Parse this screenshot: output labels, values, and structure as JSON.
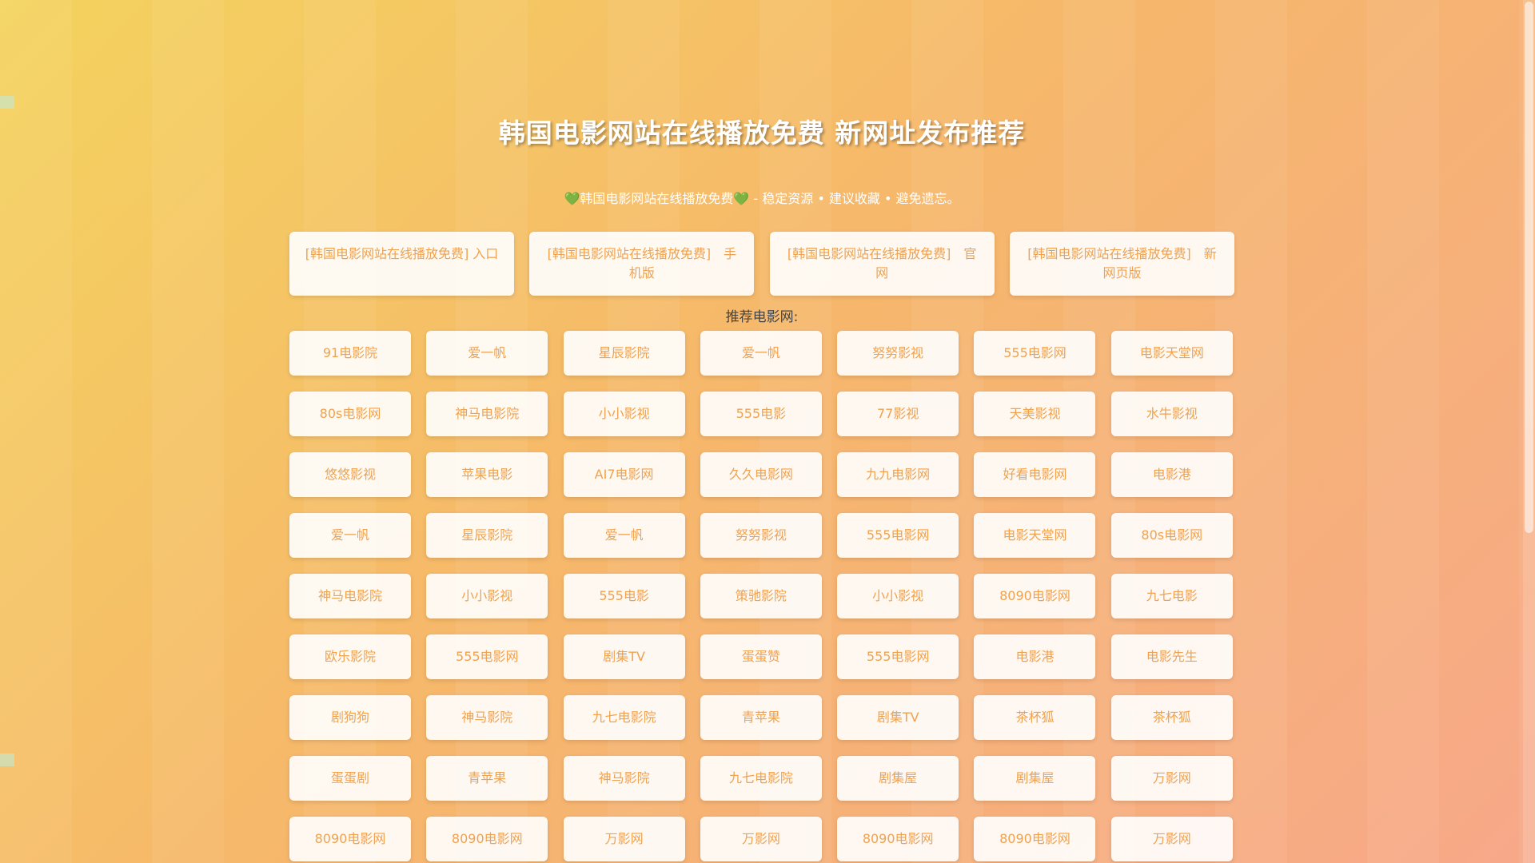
{
  "header": {
    "title": "韩国电影网站在线播放免费 新网址发布推荐",
    "subtitle": {
      "heart_left": "💚",
      "site_name": "韩国电影网站在线播放免费",
      "heart_right": "💚",
      "tagline": " - 稳定资源 • 建议收藏 • 避免遗忘。"
    }
  },
  "links": [
    "[韩国电影网站在线播放免费] 入口",
    "[韩国电影网站在线播放免费]　手机版",
    "[韩国电影网站在线播放免费]　官网",
    "[韩国电影网站在线播放免费]　新网页版"
  ],
  "recommend_label": "推荐电影网:",
  "grid": [
    "91电影院",
    "爱一帆",
    "星辰影院",
    "爱一帆",
    "努努影视",
    "555电影网",
    "电影天堂网",
    "80s电影网",
    "神马电影院",
    "小小影视",
    "555电影",
    "77影视",
    "天美影视",
    "水牛影视",
    "悠悠影视",
    "苹果电影",
    "AI7电影网",
    "久久电影网",
    "九九电影网",
    "好看电影网",
    "电影港",
    "爱一帆",
    "星辰影院",
    "爱一帆",
    "努努影视",
    "555电影网",
    "电影天堂网",
    "80s电影网",
    "神马电影院",
    "小小影视",
    "555电影",
    "策驰影院",
    "小小影视",
    "8090电影网",
    "九七电影",
    "欧乐影院",
    "555电影网",
    "剧集TV",
    "蛋蛋赞",
    "555电影网",
    "电影港",
    "电影先生",
    "剧狗狗",
    "神马影院",
    "九七电影院",
    "青苹果",
    "剧集TV",
    "茶杯狐",
    "茶杯狐",
    "蛋蛋剧",
    "青苹果",
    "神马影院",
    "九七电影院",
    "剧集屋",
    "剧集屋",
    "万影网",
    "8090电影网",
    "8090电影网",
    "万影网",
    "万影网",
    "8090电影网",
    "8090电影网",
    "万影网"
  ],
  "colors": {
    "link_text": "#f0a24e",
    "gradient_start": "#f4d35e",
    "gradient_end": "#f7a889"
  }
}
